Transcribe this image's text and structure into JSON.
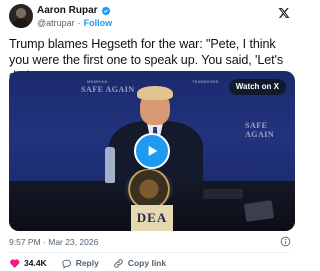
{
  "author": {
    "name": "Aaron Rupar",
    "handle": "@atrupar",
    "separator": "·",
    "follow_label": "Follow"
  },
  "tweet": {
    "text": "Trump blames Hegseth for the war: \"Pete, I think you were the first one to speak up. You said, 'Let's do it.'\""
  },
  "media": {
    "watch_label": "Watch on X",
    "backdrop_left": "SAFE AGAIN",
    "backdrop_right": "SAFE AGAIN",
    "backdrop_small": "MEMPHIS",
    "backdrop_small_right": "TENNESSEE",
    "podium_sign": "DEA"
  },
  "meta": {
    "time": "9:57 PM",
    "separator": "·",
    "date": "Mar 23, 2026"
  },
  "actions": {
    "like_count": "34.4K",
    "reply_label": "Reply",
    "copy_label": "Copy link"
  },
  "colors": {
    "accent": "#1d9bf0",
    "like": "#f91880",
    "text": "#0f1419",
    "secondary": "#536471"
  },
  "icons": [
    "verified-badge-icon",
    "x-logo-icon",
    "play-icon",
    "info-icon",
    "heart-icon",
    "reply-icon",
    "link-icon"
  ]
}
